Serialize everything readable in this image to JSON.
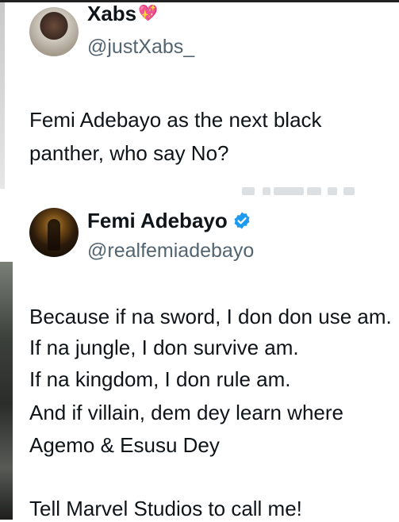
{
  "tweet": {
    "display_name": "Xabs",
    "handle": "@justXabs_",
    "text_lines": [
      "Femi Adebayo as the next black",
      "panther, who say No?"
    ]
  },
  "quoted_tweet": {
    "display_name": "Femi Adebayo",
    "handle": "@realfemiadebayo",
    "text_lines": [
      "Because if na sword, I don don use am.",
      "If na jungle, I don survive am.",
      "If na kingdom, I don rule am.",
      "And if villain, dem dey learn where",
      "Agemo & Esusu Dey",
      "",
      "Tell Marvel Studios to call me!"
    ]
  },
  "icons": {
    "heart": "sparkling-heart-icon",
    "verified": "verified-badge-icon"
  },
  "colors": {
    "text": "#0f1419",
    "secondary": "#536471",
    "verified": "#1d9bf0",
    "heart": "#e0245e"
  }
}
